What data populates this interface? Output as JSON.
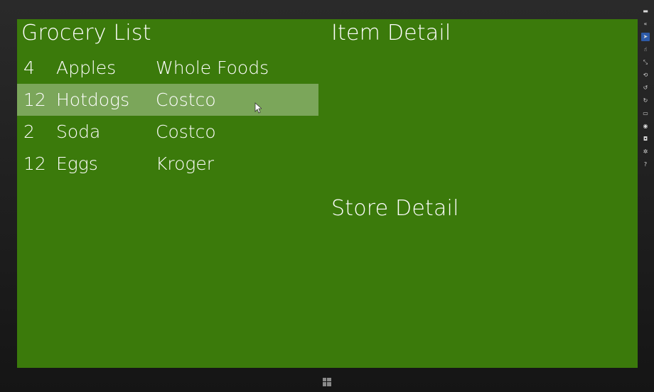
{
  "left_panel": {
    "title": "Grocery List",
    "items": [
      {
        "qty": "4",
        "name": "Apples",
        "store": "Whole Foods",
        "selected": false
      },
      {
        "qty": "12",
        "name": "Hotdogs",
        "store": "Costco",
        "selected": true
      },
      {
        "qty": "2",
        "name": "Soda",
        "store": "Costco",
        "selected": false
      },
      {
        "qty": "12",
        "name": "Eggs",
        "store": "Kroger",
        "selected": false
      }
    ]
  },
  "right_panel": {
    "item_detail_title": "Item Detail",
    "store_detail_title": "Store Detail"
  },
  "colors": {
    "background": "#3b7a0b",
    "selection": "#7ba65a",
    "text": "#ffffff"
  },
  "sidebar": {
    "icons": [
      "minimize-icon",
      "collapse-icon",
      "pointer-icon",
      "touch-icon",
      "pinch-icon",
      "rotate-icon",
      "rotate-left-icon",
      "rotate-right-icon",
      "display-icon",
      "location-icon",
      "camera-icon",
      "settings-icon",
      "help-icon"
    ],
    "active_icon": "pointer-icon"
  }
}
